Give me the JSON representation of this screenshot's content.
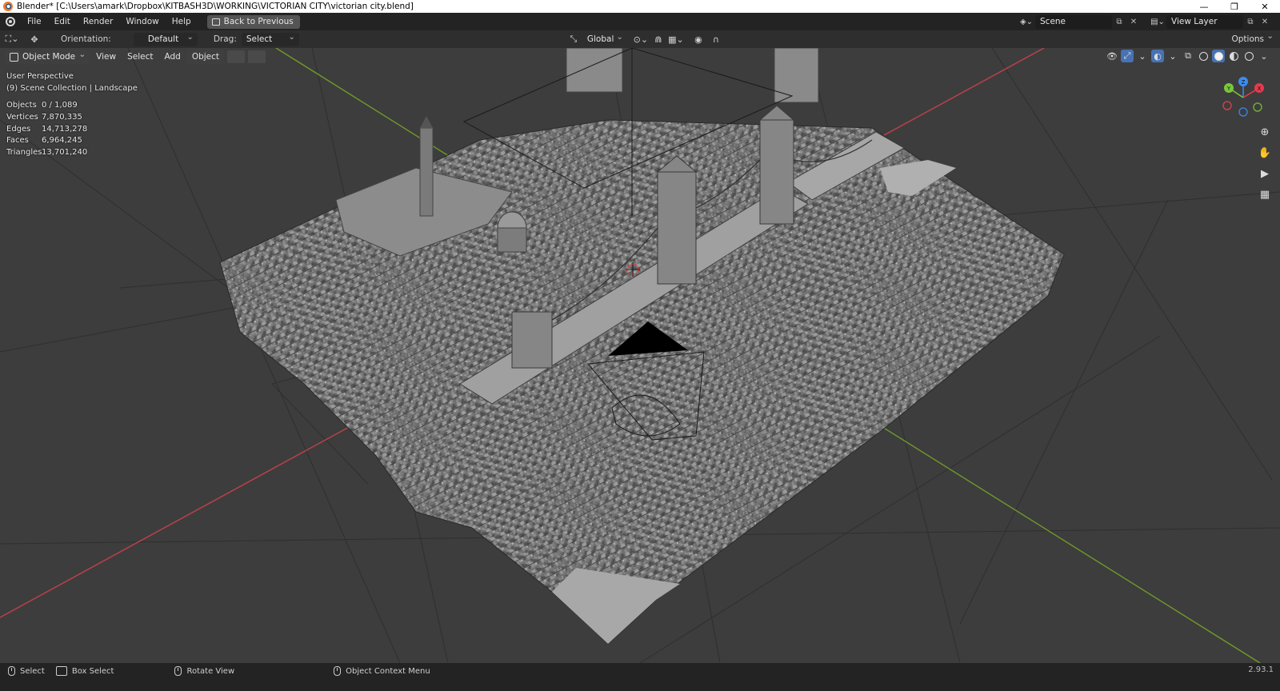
{
  "window": {
    "title": "Blender* [C:\\Users\\amark\\Dropbox\\KITBASH3D\\WORKING\\VICTORIAN CITY\\victorian city.blend]",
    "minimize": "—",
    "restore": "❐",
    "close": "✕"
  },
  "topbar": {
    "menus": [
      "File",
      "Edit",
      "Render",
      "Window",
      "Help"
    ],
    "back_button": "Back to Previous",
    "scene": "Scene",
    "view_layer": "View Layer"
  },
  "header": {
    "orientation_label": "Orientation:",
    "orientation_value": "Default",
    "drag_label": "Drag:",
    "drag_value": "Select Box",
    "transform_orientation": "Global",
    "options": "Options"
  },
  "viewport_menu": {
    "mode": "Object Mode",
    "items": [
      "View",
      "Select",
      "Add",
      "Object"
    ]
  },
  "overlay": {
    "perspective": "User Perspective",
    "collection": "(9) Scene Collection | Landscape"
  },
  "stats": [
    {
      "label": "Objects",
      "value": "0 / 1,089"
    },
    {
      "label": "Vertices",
      "value": "7,870,335"
    },
    {
      "label": "Edges",
      "value": "14,713,278"
    },
    {
      "label": "Faces",
      "value": "6,964,245"
    },
    {
      "label": "Triangles",
      "value": "13,701,240"
    }
  ],
  "gizmo": {
    "x": "X",
    "y": "Y",
    "z": "Z",
    "x_color": "#e8394f",
    "y_color": "#7ac83b",
    "z_color": "#3c8cf0"
  },
  "status_bar": {
    "select": "Select",
    "box_select": "Box Select",
    "rotate_view": "Rotate View",
    "context_menu": "Object Context Menu",
    "version": "2.93.1"
  },
  "colors": {
    "viewport_bg": "#3d3d3d",
    "x_axis": "#c2414b",
    "y_axis": "#6f9a2a",
    "accent": "#4772b3"
  }
}
